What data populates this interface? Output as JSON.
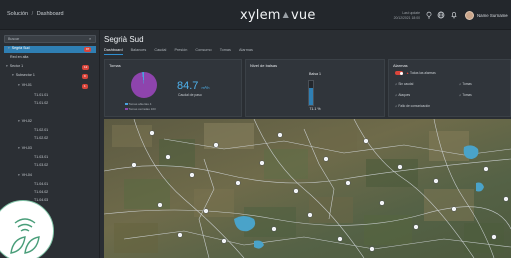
{
  "header": {
    "breadcrumb_root": "Solución",
    "breadcrumb_sep": "/",
    "breadcrumb_page": "Dashboard",
    "brand_left": "xylem",
    "brand_right": "vue",
    "last_update_label": "Last update",
    "last_update_value": "20/12/2021 18:00",
    "user_name": "Name Surname"
  },
  "sidebar": {
    "search_placeholder": "Buscar",
    "items": [
      {
        "label": "Segrià Sud",
        "badge": "97",
        "selected": true
      },
      {
        "label": "Red en alta"
      },
      {
        "label": "Sector 1",
        "badge": "12"
      },
      {
        "label": "Subsector 1",
        "badge": "9"
      },
      {
        "label": "VH-01",
        "badge": "1"
      },
      {
        "label": "T1.01.01"
      },
      {
        "label": "T1.01.02"
      },
      {
        "label": "VH-02"
      },
      {
        "label": "T1.02.01"
      },
      {
        "label": "T1.02.02"
      },
      {
        "label": "VH-03"
      },
      {
        "label": "T1.03.01"
      },
      {
        "label": "T1.03.02"
      },
      {
        "label": "VH-04"
      },
      {
        "label": "T1.04.01"
      },
      {
        "label": "T1.04.02"
      },
      {
        "label": "T1.04.03"
      }
    ]
  },
  "main": {
    "title": "Segrià Sud",
    "tabs": [
      "Dashboard",
      "Balances",
      "Caudal",
      "Presión",
      "Consumo",
      "Tomas",
      "Alarmas"
    ]
  },
  "cards": {
    "tomas": {
      "title": "Tomas",
      "legend_active": "Tomas abiertas",
      "legend_active_value": "4",
      "legend_closed": "Tomas cerradas",
      "legend_closed_value": "163",
      "value": "84.7",
      "unit": "m³/h",
      "caption": "Caudal de paso",
      "pie_color_closed": "#8e44ad",
      "pie_color_open": "#4aa3df"
    },
    "nivel": {
      "title": "Nivel de balsas",
      "tank_name": "Balsa 1",
      "tank_value": "71.1 %",
      "fill_fraction": 0.711
    },
    "alarmas": {
      "title": "Alarmas",
      "toggle_label": "Todas las alarmas",
      "items": [
        "Sin caudal",
        "Tomas",
        "Ataques",
        "Fallo de comunicación",
        "Tomas"
      ]
    }
  },
  "colors": {
    "accent": "#2f8fd0",
    "alert": "#d9453b",
    "background": "#2a2e33"
  }
}
